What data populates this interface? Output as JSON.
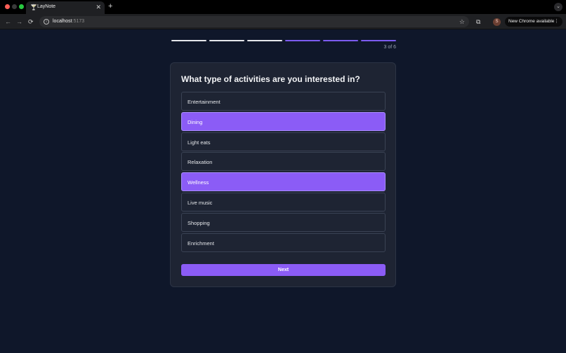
{
  "browser": {
    "tab_title": "LayNote",
    "tab_favicon": "🍸",
    "tab_close": "✕",
    "new_tab": "+",
    "tab_menu": "⌄",
    "url_host": "localhost",
    "url_port": ":5173",
    "update_label": "New Chrome available",
    "profile_initial": "S",
    "icons": {
      "back": "←",
      "forward": "→",
      "reload": "⟳",
      "info": "i",
      "star": "☆",
      "extensions": "⧉",
      "menu": "⋮"
    }
  },
  "progress": {
    "total_steps": 6,
    "current_step": 3,
    "label": "3 of 6",
    "segments": [
      "#e5e7eb",
      "#e5e7eb",
      "#e5e7eb",
      "#7c5cf0",
      "#7c5cf0",
      "#7c5cf0"
    ]
  },
  "survey": {
    "question": "What type of activities are you interested in?",
    "options": [
      {
        "label": "Entertainment",
        "selected": false
      },
      {
        "label": "Dining",
        "selected": true
      },
      {
        "label": "Light eats",
        "selected": false
      },
      {
        "label": "Relaxation",
        "selected": false
      },
      {
        "label": "Wellness",
        "selected": true
      },
      {
        "label": "Live music",
        "selected": false
      },
      {
        "label": "Shopping",
        "selected": false
      },
      {
        "label": "Enrichment",
        "selected": false
      }
    ],
    "next_label": "Next"
  },
  "colors": {
    "background": "#0f172a",
    "card": "#1e2433",
    "accent": "#8b5cf6"
  }
}
